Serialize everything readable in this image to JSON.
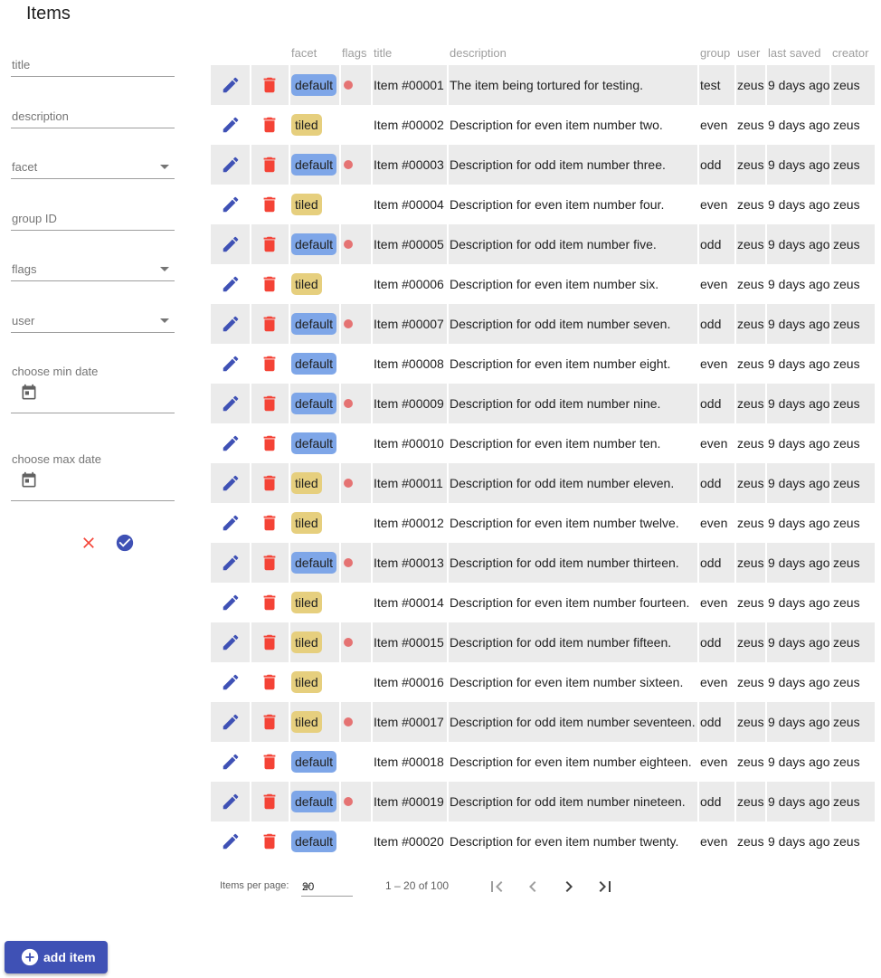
{
  "page": {
    "title": "Items"
  },
  "filters": {
    "title_placeholder": "title",
    "description_placeholder": "description",
    "facet_placeholder": "facet",
    "group_placeholder": "group ID",
    "flags_placeholder": "flags",
    "user_placeholder": "user",
    "min_date_placeholder": "choose min date",
    "max_date_placeholder": "choose max date"
  },
  "table": {
    "headers": {
      "facet": "facet",
      "flags": "flags",
      "title": "title",
      "description": "description",
      "group": "group",
      "user": "user",
      "last_saved": "last saved",
      "creator": "creator"
    },
    "rows": [
      {
        "facet": "default",
        "flag": true,
        "title": "Item #00001",
        "description": "The item being tortured for testing.",
        "group": "test",
        "user": "zeus",
        "last_saved": "9 days ago",
        "creator": "zeus"
      },
      {
        "facet": "tiled",
        "flag": false,
        "title": "Item #00002",
        "description": "Description for even item number two.",
        "group": "even",
        "user": "zeus",
        "last_saved": "9 days ago",
        "creator": "zeus"
      },
      {
        "facet": "default",
        "flag": true,
        "title": "Item #00003",
        "description": "Description for odd item number three.",
        "group": "odd",
        "user": "zeus",
        "last_saved": "9 days ago",
        "creator": "zeus"
      },
      {
        "facet": "tiled",
        "flag": false,
        "title": "Item #00004",
        "description": "Description for even item number four.",
        "group": "even",
        "user": "zeus",
        "last_saved": "9 days ago",
        "creator": "zeus"
      },
      {
        "facet": "default",
        "flag": true,
        "title": "Item #00005",
        "description": "Description for odd item number five.",
        "group": "odd",
        "user": "zeus",
        "last_saved": "9 days ago",
        "creator": "zeus"
      },
      {
        "facet": "tiled",
        "flag": false,
        "title": "Item #00006",
        "description": "Description for even item number six.",
        "group": "even",
        "user": "zeus",
        "last_saved": "9 days ago",
        "creator": "zeus"
      },
      {
        "facet": "default",
        "flag": true,
        "title": "Item #00007",
        "description": "Description for odd item number seven.",
        "group": "odd",
        "user": "zeus",
        "last_saved": "9 days ago",
        "creator": "zeus"
      },
      {
        "facet": "default",
        "flag": false,
        "title": "Item #00008",
        "description": "Description for even item number eight.",
        "group": "even",
        "user": "zeus",
        "last_saved": "9 days ago",
        "creator": "zeus"
      },
      {
        "facet": "default",
        "flag": true,
        "title": "Item #00009",
        "description": "Description for odd item number nine.",
        "group": "odd",
        "user": "zeus",
        "last_saved": "9 days ago",
        "creator": "zeus"
      },
      {
        "facet": "default",
        "flag": false,
        "title": "Item #00010",
        "description": "Description for even item number ten.",
        "group": "even",
        "user": "zeus",
        "last_saved": "9 days ago",
        "creator": "zeus"
      },
      {
        "facet": "tiled",
        "flag": true,
        "title": "Item #00011",
        "description": "Description for odd item number eleven.",
        "group": "odd",
        "user": "zeus",
        "last_saved": "9 days ago",
        "creator": "zeus"
      },
      {
        "facet": "tiled",
        "flag": false,
        "title": "Item #00012",
        "description": "Description for even item number twelve.",
        "group": "even",
        "user": "zeus",
        "last_saved": "9 days ago",
        "creator": "zeus"
      },
      {
        "facet": "default",
        "flag": true,
        "title": "Item #00013",
        "description": "Description for odd item number thirteen.",
        "group": "odd",
        "user": "zeus",
        "last_saved": "9 days ago",
        "creator": "zeus"
      },
      {
        "facet": "tiled",
        "flag": false,
        "title": "Item #00014",
        "description": "Description for even item number fourteen.",
        "group": "even",
        "user": "zeus",
        "last_saved": "9 days ago",
        "creator": "zeus"
      },
      {
        "facet": "tiled",
        "flag": true,
        "title": "Item #00015",
        "description": "Description for odd item number fifteen.",
        "group": "odd",
        "user": "zeus",
        "last_saved": "9 days ago",
        "creator": "zeus"
      },
      {
        "facet": "tiled",
        "flag": false,
        "title": "Item #00016",
        "description": "Description for even item number sixteen.",
        "group": "even",
        "user": "zeus",
        "last_saved": "9 days ago",
        "creator": "zeus"
      },
      {
        "facet": "tiled",
        "flag": true,
        "title": "Item #00017",
        "description": "Description for odd item number seventeen.",
        "group": "odd",
        "user": "zeus",
        "last_saved": "9 days ago",
        "creator": "zeus"
      },
      {
        "facet": "default",
        "flag": false,
        "title": "Item #00018",
        "description": "Description for even item number eighteen.",
        "group": "even",
        "user": "zeus",
        "last_saved": "9 days ago",
        "creator": "zeus"
      },
      {
        "facet": "default",
        "flag": true,
        "title": "Item #00019",
        "description": "Description for odd item number nineteen.",
        "group": "odd",
        "user": "zeus",
        "last_saved": "9 days ago",
        "creator": "zeus"
      },
      {
        "facet": "default",
        "flag": false,
        "title": "Item #00020",
        "description": "Description for even item number twenty.",
        "group": "even",
        "user": "zeus",
        "last_saved": "9 days ago",
        "creator": "zeus"
      }
    ]
  },
  "paginator": {
    "items_per_page_label": "Items per page:",
    "page_size": "20",
    "range_label": "1 – 20 of 100"
  },
  "actions": {
    "add_item_label": "add item"
  },
  "colors": {
    "primary": "#3f51b5",
    "danger": "#f44336",
    "chip_default": "#7ea6e8",
    "chip_tiled": "#e6cf7e",
    "flag_dot": "#e57373"
  }
}
